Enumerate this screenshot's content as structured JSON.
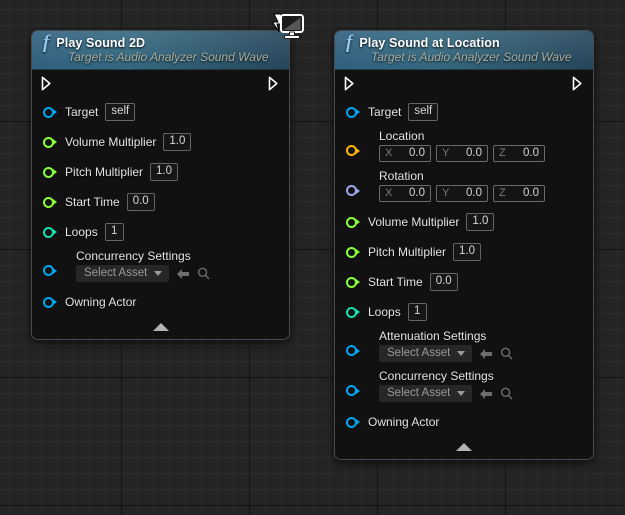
{
  "canvas": {
    "label": "Blueprint Event Graph",
    "background_color": "#242424",
    "grid_minor_color": "#2e2e2e",
    "grid_major_color": "#000000"
  },
  "overlay_icon": {
    "name": "print-to-screen-icon",
    "tooltip": "Debug screen icon"
  },
  "colors": {
    "exec_pin": "#ffffff",
    "object_pin": "#00a6f0",
    "float_pin": "#88ff3a",
    "int_pin": "#15e0b0",
    "vector_pin": "#ffb300",
    "rotator_pin": "#9fa6ec",
    "title_gradient_from": "#33687f",
    "title_gradient_to": "#24455a",
    "node_body": "#111111",
    "node_border": "#96aab9"
  },
  "nodes": [
    {
      "id": "play-sound-2d",
      "title": "Play Sound 2D",
      "subtitle": "Target is Audio Analyzer Sound Wave",
      "fn_glyph": "f",
      "exec_in": "",
      "exec_out": "",
      "advanced_toggle": "collapse-advanced-pins",
      "pins": [
        {
          "label": "Target",
          "type": "object",
          "widget": "value",
          "value": "self"
        },
        {
          "label": "Volume Multiplier",
          "type": "float",
          "widget": "value",
          "value": "1.0"
        },
        {
          "label": "Pitch Multiplier",
          "type": "float",
          "widget": "value",
          "value": "1.0"
        },
        {
          "label": "Start Time",
          "type": "float",
          "widget": "value",
          "value": "0.0"
        },
        {
          "label": "Loops",
          "type": "int",
          "widget": "value",
          "value": "1"
        },
        {
          "label": "Concurrency Settings",
          "type": "object",
          "widget": "asset",
          "value": "Select Asset"
        },
        {
          "label": "Owning Actor",
          "type": "object",
          "widget": "none",
          "value": ""
        }
      ]
    },
    {
      "id": "play-sound-at-location",
      "title": "Play Sound at Location",
      "subtitle": "Target is Audio Analyzer Sound Wave",
      "fn_glyph": "f",
      "exec_in": "",
      "exec_out": "",
      "advanced_toggle": "collapse-advanced-pins",
      "pins": [
        {
          "label": "Target",
          "type": "object",
          "widget": "value",
          "value": "self"
        },
        {
          "label": "Location",
          "type": "vector",
          "widget": "vector",
          "axes": [
            "X",
            "Y",
            "Z"
          ],
          "values": [
            "0.0",
            "0.0",
            "0.0"
          ]
        },
        {
          "label": "Rotation",
          "type": "rotator",
          "widget": "vector",
          "axes": [
            "X",
            "Y",
            "Z"
          ],
          "values": [
            "0.0",
            "0.0",
            "0.0"
          ]
        },
        {
          "label": "Volume Multiplier",
          "type": "float",
          "widget": "value",
          "value": "1.0"
        },
        {
          "label": "Pitch Multiplier",
          "type": "float",
          "widget": "value",
          "value": "1.0"
        },
        {
          "label": "Start Time",
          "type": "float",
          "widget": "value",
          "value": "0.0"
        },
        {
          "label": "Loops",
          "type": "int",
          "widget": "value",
          "value": "1"
        },
        {
          "label": "Attenuation Settings",
          "type": "object",
          "widget": "asset",
          "value": "Select Asset"
        },
        {
          "label": "Concurrency Settings",
          "type": "object",
          "widget": "asset",
          "value": "Select Asset"
        },
        {
          "label": "Owning Actor",
          "type": "object",
          "widget": "none",
          "value": ""
        }
      ]
    }
  ]
}
